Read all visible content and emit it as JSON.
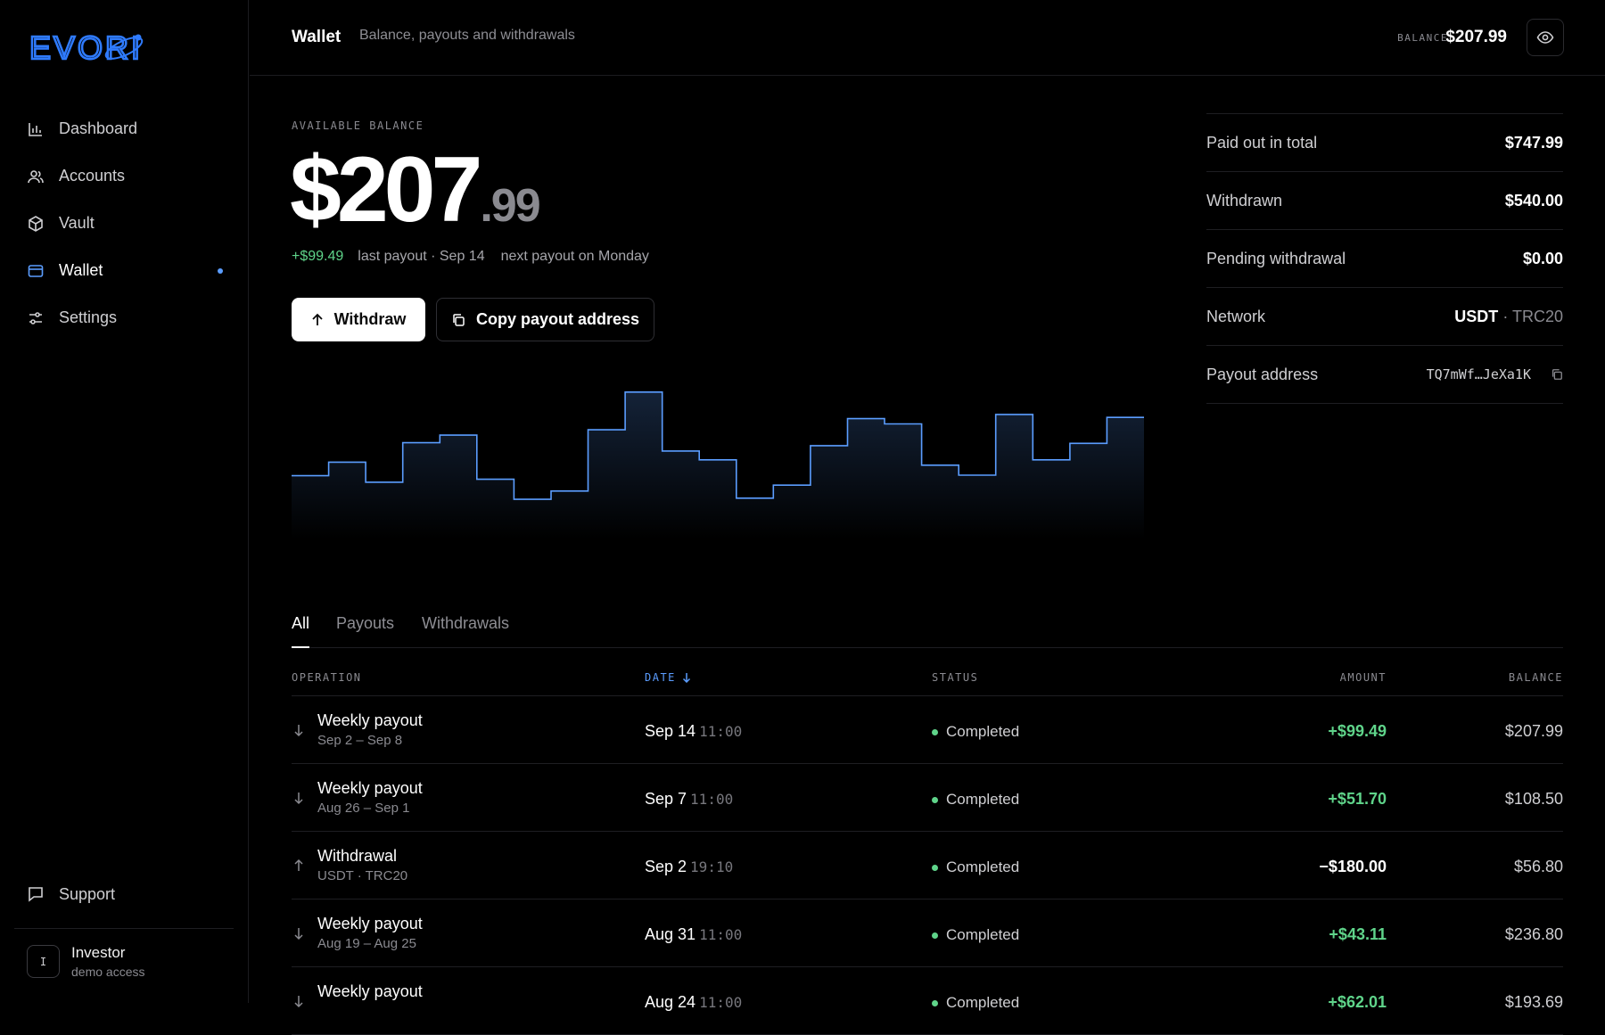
{
  "brand": {
    "name": "EVORI",
    "color": "#2f7bff"
  },
  "sidebar": {
    "items": [
      {
        "label": "Dashboard",
        "icon": "bar-chart-icon"
      },
      {
        "label": "Accounts",
        "icon": "users-icon"
      },
      {
        "label": "Vault",
        "icon": "box-icon"
      },
      {
        "label": "Wallet",
        "icon": "wallet-icon",
        "active": true
      },
      {
        "label": "Settings",
        "icon": "sliders-icon"
      }
    ],
    "support_label": "Support",
    "user": {
      "initial": "I",
      "name": "Investor",
      "sub": "demo access"
    }
  },
  "header": {
    "title": "Wallet",
    "subtitle": "Balance, payouts and withdrawals",
    "balance_label": "BALANCE",
    "balance_value": "$207.99"
  },
  "summary": {
    "available_label": "AVAILABLE BALANCE",
    "balance_int": "$207",
    "balance_dec": ".99",
    "last_payout_amount": "+$99.49",
    "last_payout_text": "last payout · Sep 14",
    "next_payout_text": "next payout on Monday",
    "withdraw_label": "Withdraw",
    "copy_label": "Copy payout address"
  },
  "stats": {
    "paid_out_label": "Paid out in total",
    "paid_out_value": "$747.99",
    "withdrawn_label": "Withdrawn",
    "withdrawn_value": "$540.00",
    "pending_label": "Pending withdrawal",
    "pending_value": "$0.00",
    "network_label": "Network",
    "network_value": "USDT",
    "network_sub": "· TRC20",
    "address_label": "Payout address",
    "address_value": "TQ7mWf…JeXa1K"
  },
  "chart_data": {
    "type": "area",
    "step": true,
    "values": [
      108,
      131,
      97,
      164,
      177,
      102,
      68,
      82,
      186,
      250,
      150,
      135,
      70,
      92,
      159,
      205,
      196,
      126,
      109,
      212,
      135,
      163,
      207
    ],
    "ylim": [
      0,
      280
    ],
    "color": "#5b9dff"
  },
  "tabs": [
    {
      "label": "All",
      "active": true
    },
    {
      "label": "Payouts"
    },
    {
      "label": "Withdrawals"
    }
  ],
  "table": {
    "headers": {
      "operation": "OPERATION",
      "date": "DATE",
      "status": "STATUS",
      "amount": "AMOUNT",
      "balance": "BALANCE"
    },
    "rows": [
      {
        "type": "in",
        "title": "Weekly payout",
        "sub": "Sep 2 – Sep 8",
        "date": "Sep 14",
        "time": "11:00",
        "status": "Completed",
        "amount": "+$99.49",
        "balance": "$207.99"
      },
      {
        "type": "in",
        "title": "Weekly payout",
        "sub": "Aug 26 – Sep 1",
        "date": "Sep 7",
        "time": "11:00",
        "status": "Completed",
        "amount": "+$51.70",
        "balance": "$108.50"
      },
      {
        "type": "out",
        "title": "Withdrawal",
        "sub": "USDT · TRC20",
        "date": "Sep 2",
        "time": "19:10",
        "status": "Completed",
        "amount": "−$180.00",
        "balance": "$56.80"
      },
      {
        "type": "in",
        "title": "Weekly payout",
        "sub": "Aug 19 – Aug 25",
        "date": "Aug 31",
        "time": "11:00",
        "status": "Completed",
        "amount": "+$43.11",
        "balance": "$236.80"
      },
      {
        "type": "in",
        "title": "Weekly payout",
        "sub": "",
        "date": "Aug 24",
        "time": "11:00",
        "status": "Completed",
        "amount": "+$62.01",
        "balance": "$193.69"
      }
    ]
  },
  "colors": {
    "positive": "#5fd48a",
    "accent": "#5b9dff",
    "muted": "#8a8a90"
  }
}
